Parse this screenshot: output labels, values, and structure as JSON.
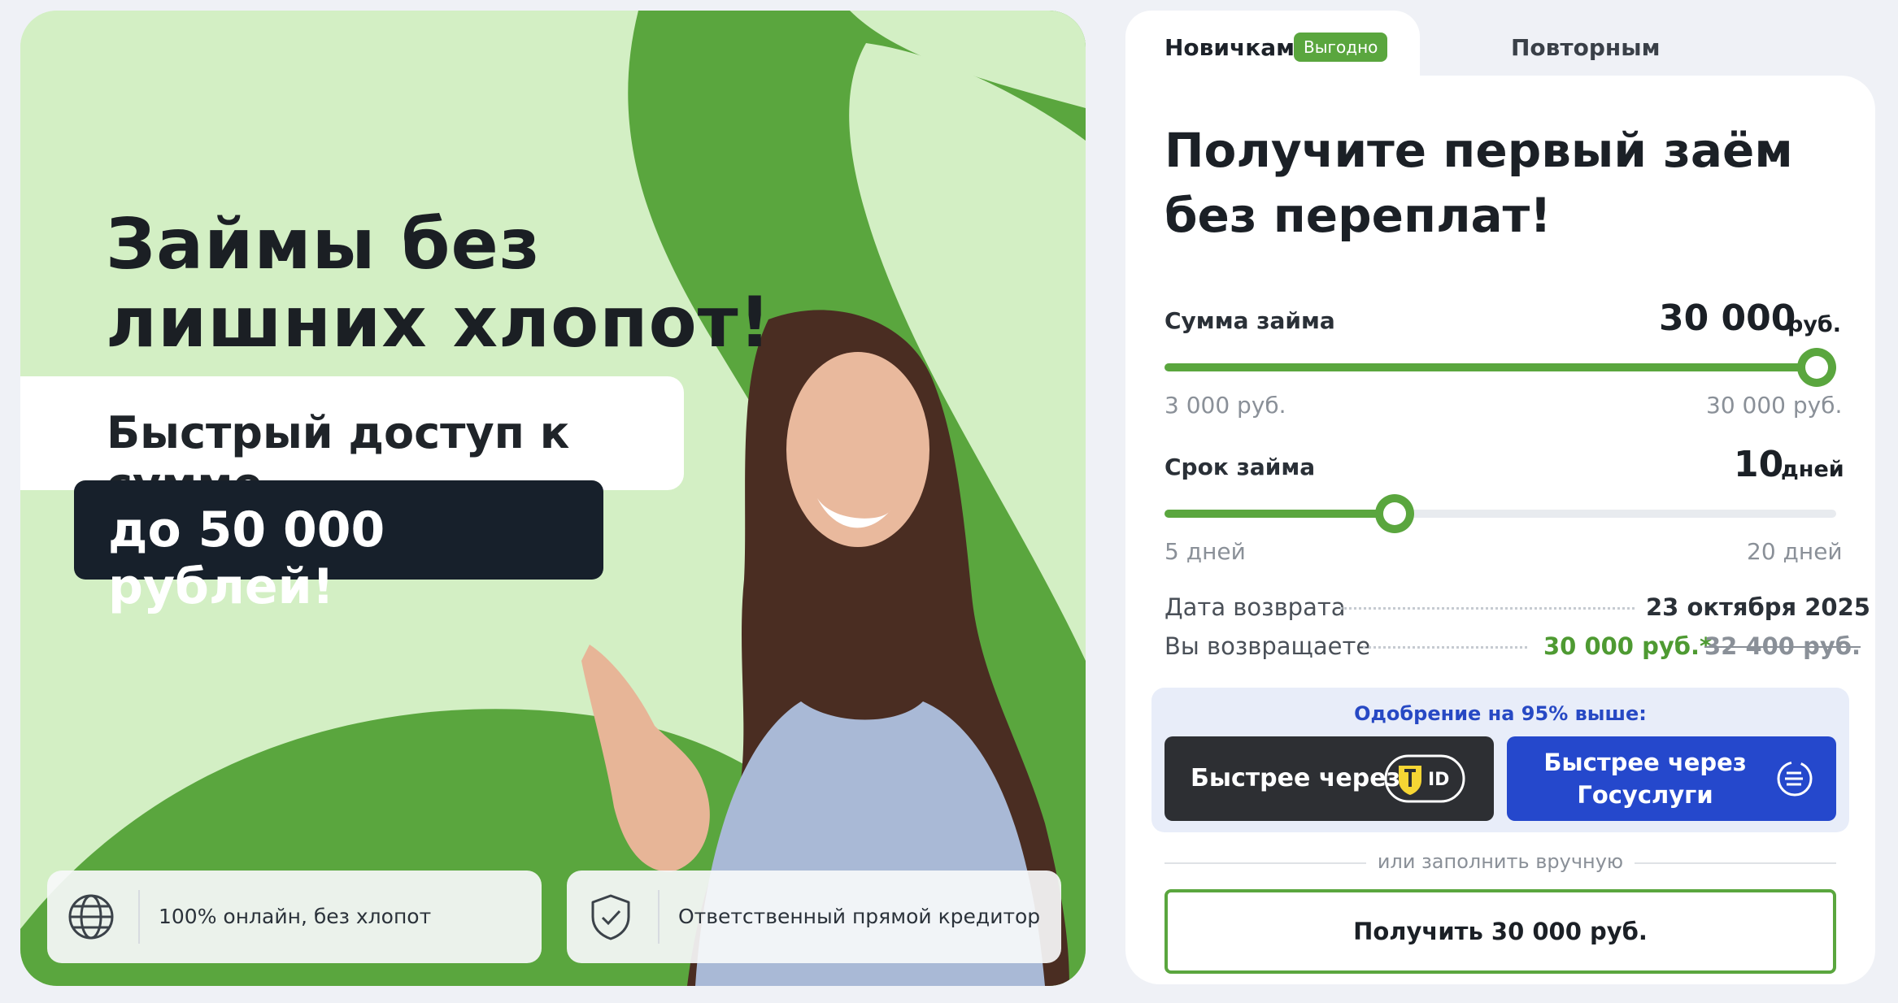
{
  "banner": {
    "headline_line1": "Займы без",
    "headline_line2": "лишних хлопот!",
    "strip_text": "Быстрый доступ к сумме",
    "pill_text": "до 50 000 рублей!",
    "features": [
      {
        "icon": "globe-icon",
        "text": "100% онлайн, без хлопот"
      },
      {
        "icon": "shield-check-icon",
        "text": "Ответственный прямой кредитор"
      }
    ],
    "colors": {
      "light_green": "#d3efc4",
      "brand_green": "#5aa63e"
    }
  },
  "tabs": {
    "active": "Новичкам",
    "active_badge": "Выгодно",
    "inactive": "Повторным"
  },
  "form": {
    "title_line1": "Получите первый заём",
    "title_line2": "без переплат!",
    "amount": {
      "label": "Сумма займа",
      "value": "30 000",
      "unit": "руб.",
      "min_label": "3 000 руб.",
      "max_label": "30 000 руб.",
      "fraction": 1.0
    },
    "term": {
      "label": "Срок займа",
      "value": "10",
      "unit": "дней",
      "min_label": "5 дней",
      "max_label": "20 дней",
      "fraction": 0.343
    },
    "return_date": {
      "label": "Дата возврата",
      "value": "23 октября 2025"
    },
    "repay": {
      "label": "Вы возвращаете",
      "value": "30 000 руб.*",
      "old_value": "32 400 руб."
    },
    "approval_text": "Одобрение на 95% выше:",
    "btn_tid": {
      "text": "Быстрее через",
      "logo": "ID"
    },
    "btn_gos": {
      "line1": "Быстрее через",
      "line2": "Госуслуги"
    },
    "or_text": "или заполнить вручную",
    "cta": "Получить 30 000 руб."
  }
}
